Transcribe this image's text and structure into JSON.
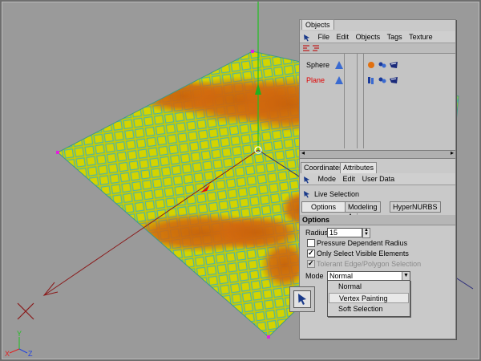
{
  "colors": {
    "viewport_bg": "#9a9a9a",
    "plane_yellow": "#c9cc00",
    "plane_orange": "#d2680e",
    "grid_cyan": "#4fb6a4",
    "panel_bg": "#c9c9c9",
    "plane_label_red": "#e00000"
  },
  "axes": {
    "y": "Y",
    "x": "X",
    "z": "Z"
  },
  "objects_panel": {
    "title_tab": "Objects",
    "menu": [
      "File",
      "Edit",
      "Objects",
      "Tags",
      "Texture"
    ],
    "objects": [
      {
        "name": "Sphere"
      },
      {
        "name": "Plane"
      }
    ]
  },
  "attributes_panel": {
    "tabs": [
      "Coordinates",
      "Attributes"
    ],
    "menu": [
      "Mode",
      "Edit",
      "User Data"
    ],
    "tool_name": "Live Selection",
    "subtabs": [
      "Options",
      "Modeling Axis",
      "HyperNURBS"
    ],
    "section": "Options",
    "radius_label": "Radius",
    "radius_value": "15",
    "pressure_label": "Pressure Dependent Radius",
    "only_visible_label": "Only Select Visible Elements",
    "tolerant_label": "Tolerant Edge/Polygon Selection",
    "mode_label": "Mode",
    "mode_value": "Normal",
    "mode_options": [
      "Normal",
      "Vertex Painting",
      "Soft Selection"
    ]
  }
}
